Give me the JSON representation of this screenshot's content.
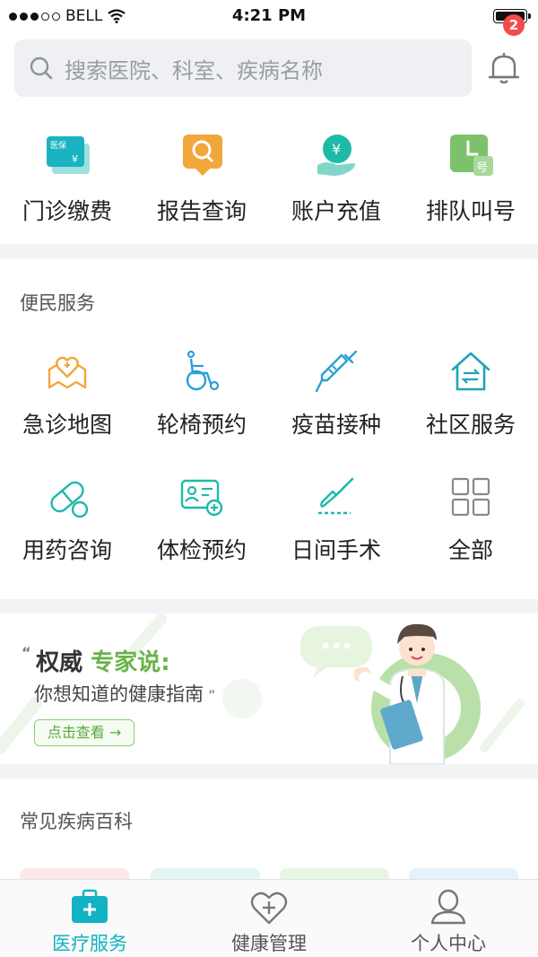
{
  "status_bar": {
    "carrier": "BELL",
    "time": "4:21 PM"
  },
  "search": {
    "placeholder": "搜索医院、科室、疾病名称"
  },
  "notifications": {
    "count": "2"
  },
  "quick_actions": [
    {
      "label": "门诊缴费",
      "icon": "medical-insurance-card-icon"
    },
    {
      "label": "报告查询",
      "icon": "report-search-icon"
    },
    {
      "label": "账户充值",
      "icon": "hand-coin-icon"
    },
    {
      "label": "排队叫号",
      "icon": "queue-clock-icon"
    }
  ],
  "services": {
    "title": "便民服务",
    "items": [
      {
        "label": "急诊地图",
        "icon": "heart-map-icon"
      },
      {
        "label": "轮椅预约",
        "icon": "wheelchair-icon"
      },
      {
        "label": "疫苗接种",
        "icon": "syringe-icon"
      },
      {
        "label": "社区服务",
        "icon": "community-house-icon"
      },
      {
        "label": "用药咨询",
        "icon": "pill-capsule-icon"
      },
      {
        "label": "体检预约",
        "icon": "id-card-add-icon"
      },
      {
        "label": "日间手术",
        "icon": "scalpel-icon"
      },
      {
        "label": "全部",
        "icon": "grid-all-icon"
      }
    ]
  },
  "banner": {
    "title_prefix": "权威",
    "title_highlight": "专家说",
    "subtitle": "你想知道的健康指南",
    "button_label": "点击查看 →"
  },
  "encyclopedia": {
    "title": "常见疾病百科"
  },
  "tabbar": {
    "tabs": [
      {
        "label": "医疗服务",
        "icon": "medical-kit-icon",
        "active": true
      },
      {
        "label": "健康管理",
        "icon": "heart-plus-icon",
        "active": false
      },
      {
        "label": "个人中心",
        "icon": "person-icon",
        "active": false
      }
    ]
  },
  "colors": {
    "accent": "#12b3c3",
    "badge": "#f24b4b",
    "banner_green": "#6ab34a",
    "orange": "#f2a73b",
    "teal": "#1fb9a8",
    "blue_icon": "#2a9fd6"
  }
}
